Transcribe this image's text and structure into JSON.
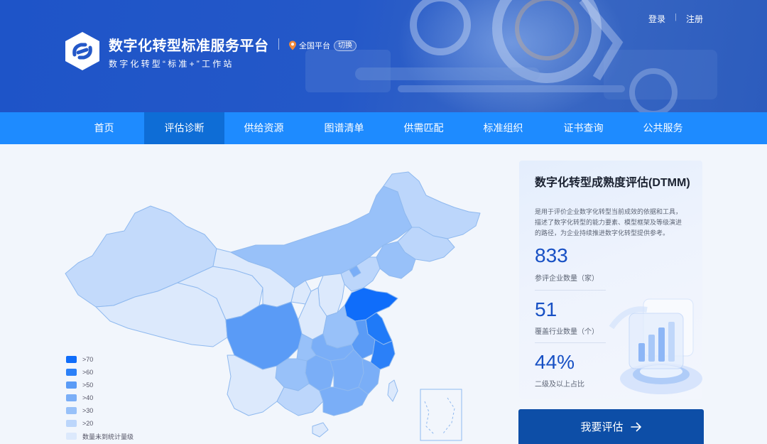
{
  "header": {
    "site_title": "数字化转型标准服务平台",
    "site_subtitle": "数字化转型“标准+”工作站",
    "region_label": "全国平台",
    "region_switch": "切换",
    "login": "登录",
    "separator": "|",
    "register": "注册"
  },
  "nav": {
    "items": [
      {
        "label": "首页",
        "active": false
      },
      {
        "label": "评估诊断",
        "active": true
      },
      {
        "label": "供给资源",
        "active": false
      },
      {
        "label": "图谱清单",
        "active": false
      },
      {
        "label": "供需匹配",
        "active": false
      },
      {
        "label": "标准组织",
        "active": false
      },
      {
        "label": "证书查询",
        "active": false
      },
      {
        "label": "公共服务",
        "active": false
      }
    ]
  },
  "legend": {
    "items": [
      {
        "label": ">70",
        "color": "#0f6dfa"
      },
      {
        "label": ">60",
        "color": "#2b80f8"
      },
      {
        "label": ">50",
        "color": "#5a9bf6"
      },
      {
        "label": ">40",
        "color": "#7aaef7"
      },
      {
        "label": ">30",
        "color": "#98c1f9"
      },
      {
        "label": ">20",
        "color": "#bcd6fb"
      },
      {
        "label": "数量未到统计量级",
        "color": "#dce9fc"
      }
    ]
  },
  "card": {
    "title": "数字化转型成熟度评估(DTMM)",
    "description": "是用于评价企业数字化转型当前成效的依据和工具，描述了数字化转型的能力要素、模型框架及等级演进的路径，为企业持续推进数字化转型提供参考。",
    "stats": [
      {
        "value": "833",
        "label": "参评企业数量（家）"
      },
      {
        "value": "51",
        "label": "覆盖行业数量（个）"
      },
      {
        "value": "44%",
        "label": "二级及以上占比"
      }
    ]
  },
  "cta": {
    "label": "我要评估"
  },
  "colors": {
    "nav_bg": "#1e8bff",
    "nav_active": "#0e6dd6",
    "cta_bg": "#0d4ea7",
    "stat_blue": "#1750c4"
  }
}
